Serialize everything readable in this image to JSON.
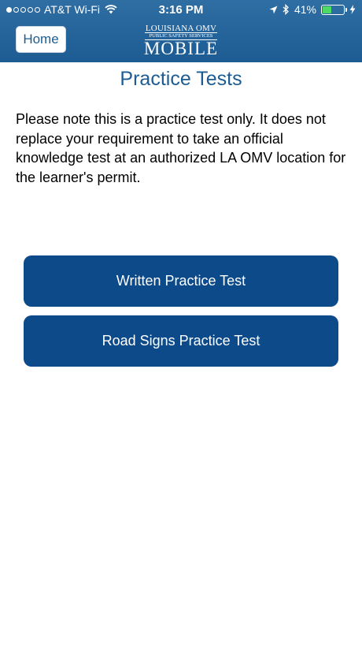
{
  "status_bar": {
    "carrier": "AT&T Wi-Fi",
    "time": "3:16 PM",
    "battery": "41%",
    "battery_level": 0.41,
    "icons": [
      "signal-dots-icon",
      "wifi-icon",
      "location-arrow-icon",
      "bluetooth-icon",
      "battery-icon",
      "charging-bolt-icon"
    ]
  },
  "header": {
    "home_label": "Home",
    "logo": {
      "line1": "LOUISIANA OMV",
      "line2": "PUBLIC SAFETY SERVICES",
      "line3": "MOBILE"
    },
    "background_color": "#1d5c93"
  },
  "main": {
    "title": "Practice Tests",
    "note": "Please note this is a practice test only. It does not replace your requirement to take an official knowledge test at an authorized LA OMV location for the learner's permit.",
    "buttons": [
      {
        "label": "Written Practice Test"
      },
      {
        "label": "Road Signs Practice Test"
      }
    ],
    "button_color": "#0c4a8a",
    "title_color": "#1d5c93"
  }
}
